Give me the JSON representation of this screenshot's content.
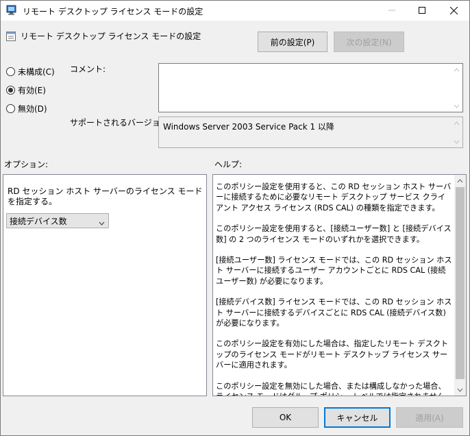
{
  "window": {
    "title": "リモート デスクトップ ライセンス モードの設定",
    "controls": [
      "minimize-icon",
      "maximize-icon",
      "close-icon"
    ]
  },
  "header": {
    "policy_name": "リモート デスクトップ ライセンス モードの設定",
    "prev_label": "前の設定(P)",
    "next_label": "次の設定(N)"
  },
  "state": {
    "options": [
      {
        "label": "未構成(C)",
        "checked": false
      },
      {
        "label": "有効(E)",
        "checked": true
      },
      {
        "label": "無効(D)",
        "checked": false
      }
    ]
  },
  "comment": {
    "label": "コメント:",
    "value": ""
  },
  "supported": {
    "label": "サポートされるバージョン:",
    "value": "Windows Server 2003 Service Pack 1 以降"
  },
  "options_section": {
    "label": "オプション:",
    "description": "RD セッション ホスト サーバーのライセンス モードを指定する。",
    "selected": "接続デバイス数"
  },
  "help_section": {
    "label": "ヘルプ:",
    "paragraphs": [
      "このポリシー設定を使用すると、この RD セッション ホスト サーバーに接続するために必要なリモート デスクトップ サービス クライアント アクセス ライセンス (RDS CAL) の種類を指定できます。",
      "このポリシー設定を使用すると、[接続ユーザー数] と [接続デバイス数] の 2 つのライセンス モードのいずれかを選択できます。",
      "[接続ユーザー数] ライセンス モードでは、この RD セッション ホスト サーバーに接続するユーザー アカウントごとに RDS CAL (接続ユーザー数) が必要になります。",
      "[接続デバイス数] ライセンス モードでは、この RD セッション ホスト サーバーに接続するデバイスごとに RDS CAL (接続デバイス数) が必要になります。",
      "このポリシー設定を有効にした場合は、指定したリモート デスクトップのライセンス モードがリモート デスクトップ ライセンス サーバーに適用されます。",
      "このポリシー設定を無効にした場合、または構成しなかった場合、ライセンス モードはグループ ポリシー レベルでは指定されません。"
    ]
  },
  "footer": {
    "ok_label": "OK",
    "cancel_label": "キャンセル",
    "apply_label": "適用(A)"
  },
  "colors": {
    "background": "#f0f0f0",
    "accent": "#0078d7",
    "disabled_text": "#a0a0a0"
  }
}
